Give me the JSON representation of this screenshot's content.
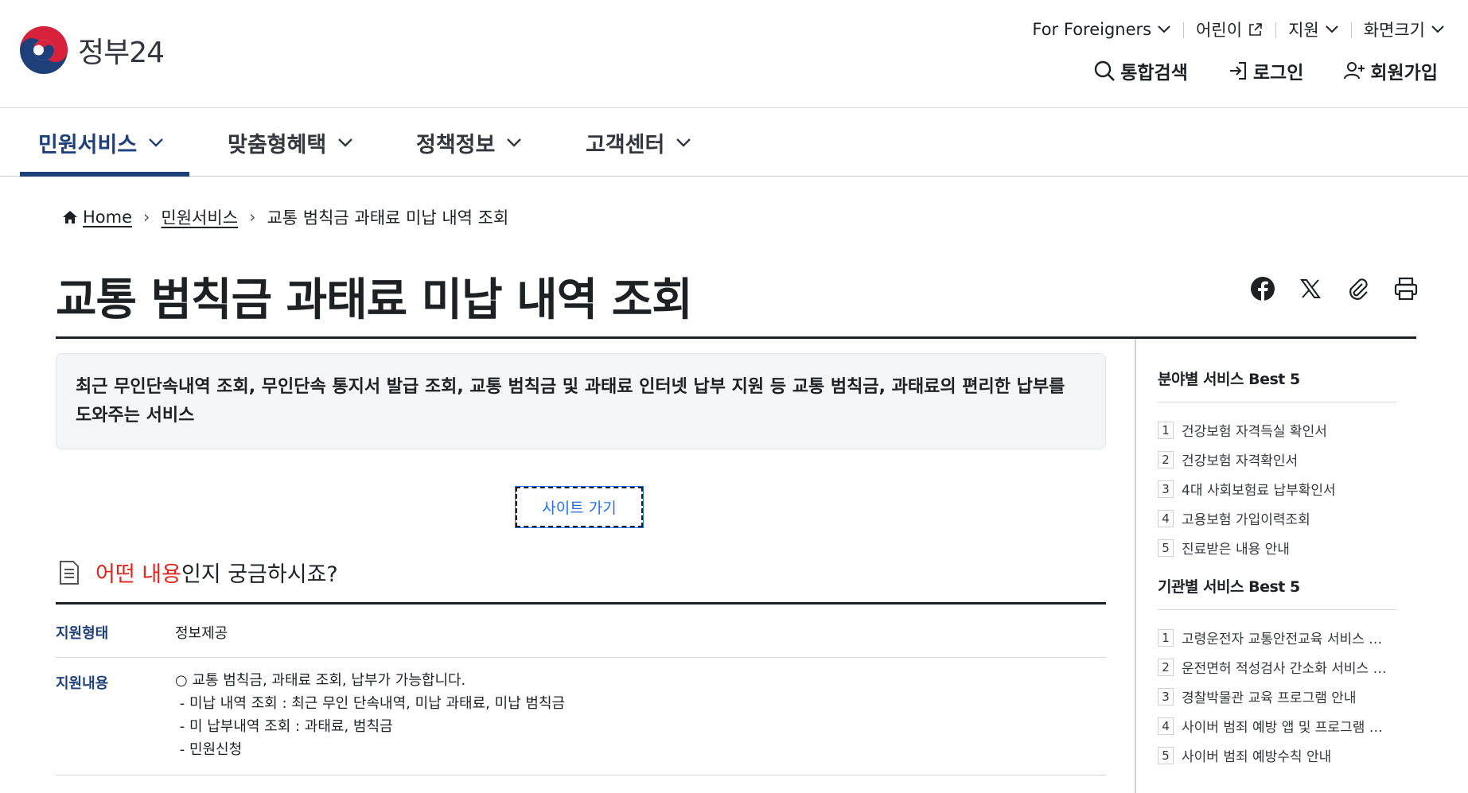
{
  "header": {
    "logo_text": "정부24",
    "util": [
      "For Foreigners",
      "어린이",
      "지원",
      "화면크기"
    ],
    "actions": {
      "search": "통합검색",
      "login": "로그인",
      "join": "회원가입"
    }
  },
  "gnb": [
    "민원서비스",
    "맞춤형혜택",
    "정책정보",
    "고객센터"
  ],
  "breadcrumb": {
    "home": "Home",
    "level1": "민원서비스",
    "current": "교통 범칙금 과태료 미납 내역 조회"
  },
  "page_title": "교통 범칙금 과태료 미납 내역 조회",
  "summary": "최근 무인단속내역 조회, 무인단속 통지서 발급 조회, 교통 범칙금 및 과태료 인터넷 납부 지원 등 교통 범칙금, 과태료의 편리한 납부를 도와주는 서비스",
  "site_button": "사이트 가기",
  "section": {
    "highlight": "어떤 내용",
    "rest": "인지 궁금하시죠?"
  },
  "info": {
    "type_label": "지원형태",
    "type_value": "정보제공",
    "content_label": "지원내용",
    "content_lines": [
      "○ 교통 범칙금, 과태료 조회, 납부가 가능합니다.",
      " - 미납 내역 조회 : 최근 무인 단속내역, 미납 과태료, 미납 범칙금",
      " - 미 납부내역 조회 : 과태료, 범칙금",
      " - 민원신청"
    ]
  },
  "sidebar": {
    "field_title": "분야별 서비스 Best 5",
    "field_items": [
      "건강보험 자격득실 확인서",
      "건강보험 자격확인서",
      "4대 사회보험료 납부확인서",
      "고용보험 가입이력조회",
      "진료받은 내용 안내"
    ],
    "org_title": "기관별 서비스 Best 5",
    "org_items": [
      "고령운전자 교통안전교육 서비스 안내",
      "운전면허 적성검사 간소화 서비스 안내",
      "경찰박물관 교육 프로그램 안내",
      "사이버 범죄 예방 앱 및 프로그램 안내",
      "사이버 범죄 예방수칙 안내"
    ],
    "numbers": [
      "1",
      "2",
      "3",
      "4",
      "5"
    ]
  },
  "colors": {
    "brand_navy": "#1f3f7a",
    "accent_red": "#e0261e",
    "link_blue": "#256ef4"
  }
}
